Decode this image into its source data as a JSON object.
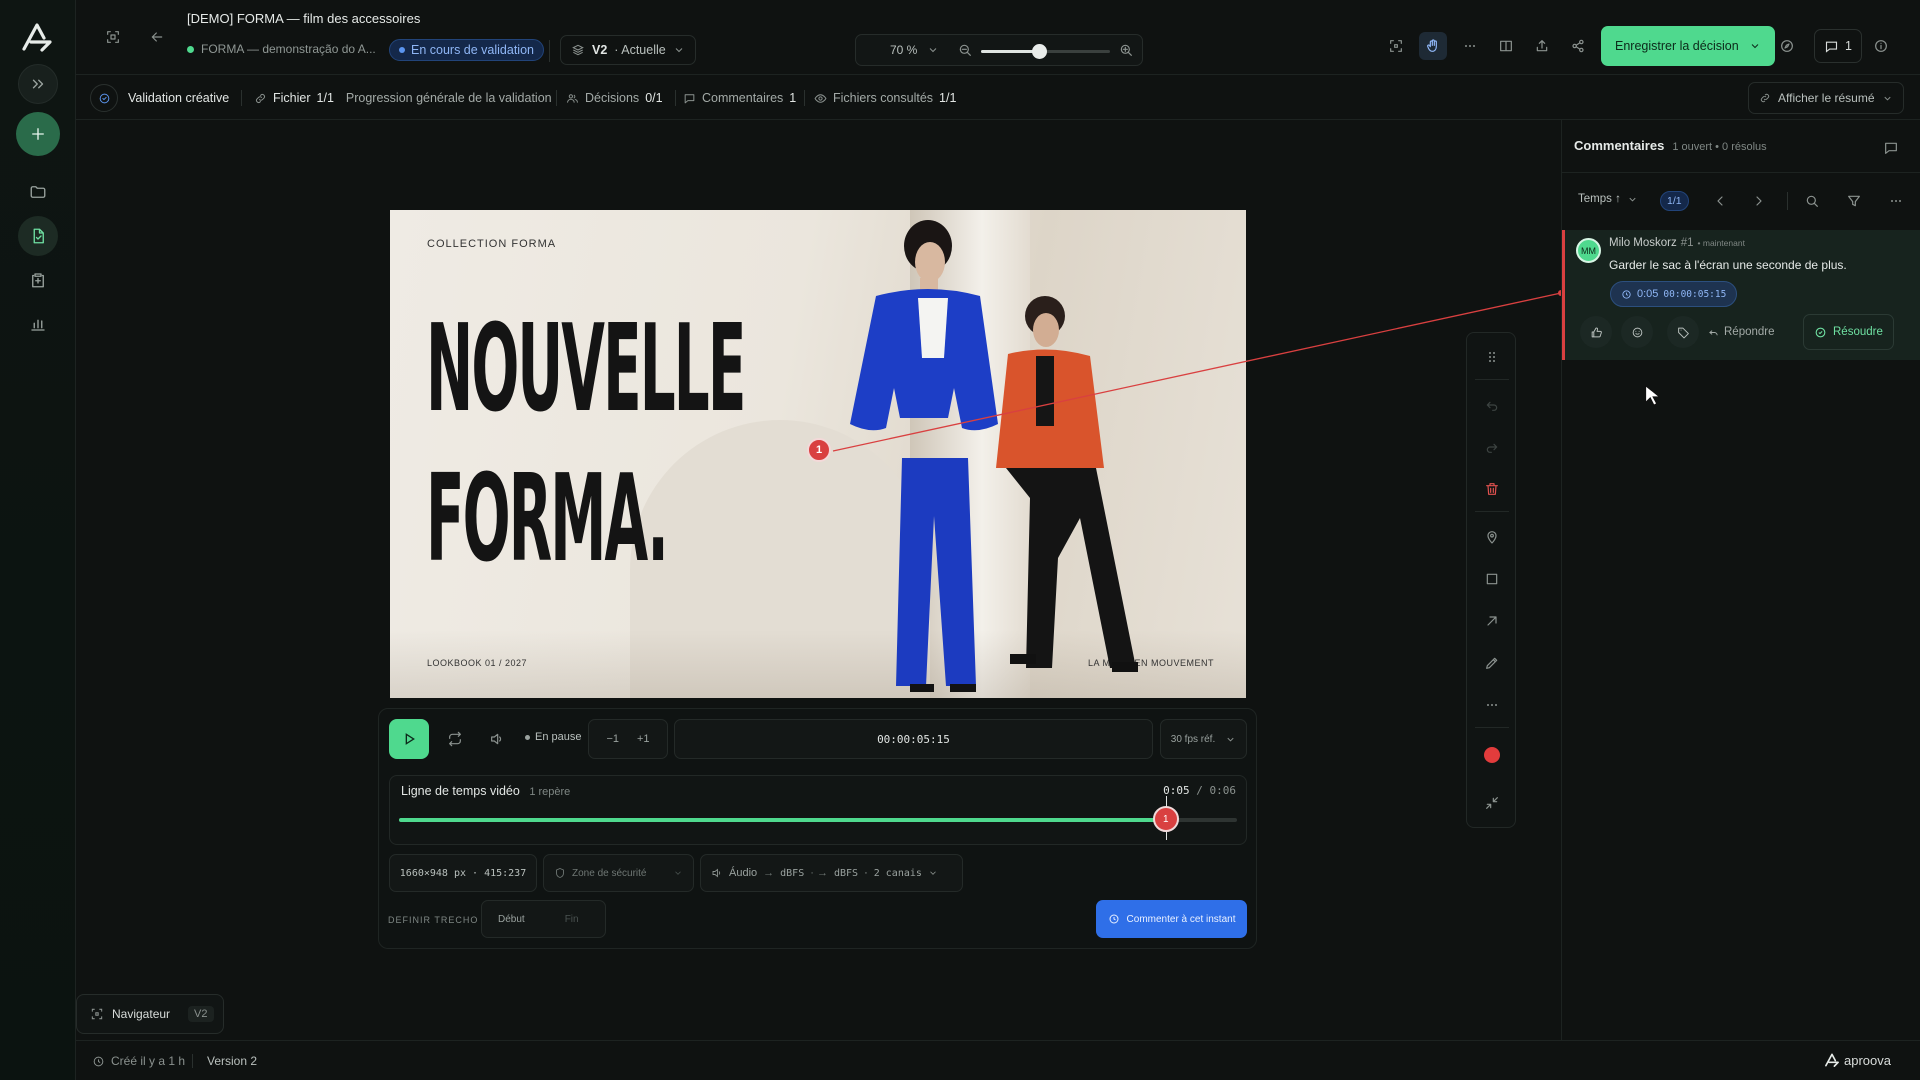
{
  "app": {
    "logo_name": "aproova",
    "brand_color": "#4fd98e",
    "accent_blue": "#2f6fe8",
    "marker_red": "#d94040"
  },
  "header": {
    "title": "[DEMO] FORMA — film des accessoires",
    "project": "FORMA — demonstração do A...",
    "status": "En cours de validation",
    "version_label": "V2",
    "version_state": "· Actuelle",
    "zoom": "70 %",
    "zoom_value": 0.45,
    "decision_button": "Enregistrer la décision",
    "comments_count": "1"
  },
  "subbar": {
    "validation": "Validation créative",
    "file_label": "Fichier",
    "file_value": "1/1",
    "progress": "Progression générale de la validation",
    "decisions_label": "Décisions",
    "decisions_value": "0/1",
    "comments_label": "Commentaires",
    "comments_value": "1",
    "viewed_label": "Fichiers consultés",
    "viewed_value": "1/1",
    "summary": "Afficher le résumé"
  },
  "poster": {
    "collection": "COLLECTION FORMA",
    "headline_1": "NOUVELLE",
    "headline_2": "FORMA.",
    "lookbook": "LOOKBOOK 01 / 2027",
    "tagline": "LA MODE EN MOUVEMENT",
    "marker": "1"
  },
  "player": {
    "state": "En pause",
    "minus": "−1",
    "plus": "+1",
    "timecode": "00:00:05:15",
    "fps": "30 fps réf.",
    "timeline_title": "Ligne de temps vidéo",
    "timeline_markers": "1 repère",
    "current": "0:05",
    "slash": "/",
    "duration": "0:06",
    "progress": 0.915,
    "playhead_marker": "1",
    "resolution": "1660×948 px · 415:237",
    "safe_zone": "Zone de sécurité",
    "audio_label": "Áudio",
    "audio_l": "dBFS",
    "audio_r": "dBFS",
    "channels": "2 canais",
    "define_range": "DEFINIR TRECHO",
    "start": "Début",
    "end": "Fin",
    "comment_button": "Commenter à cet instant"
  },
  "comments": {
    "title": "Commentaires",
    "meta": "1 ouvert • 0 résolus",
    "sort": "Temps ↑",
    "pager": "1/1",
    "items": [
      {
        "initials": "MM",
        "author": "Milo Moskorz",
        "number": "#1",
        "when": "• maintenant",
        "text": "Garder le sac à l'écran une seconde de plus.",
        "time_short": "0:05",
        "time_code": "00:00:05:15",
        "reply": "Répondre",
        "resolve": "Résoudre"
      }
    ]
  },
  "navigator": {
    "label": "Navigateur",
    "version": "V2"
  },
  "footer": {
    "created": "Créé il y a 1 h",
    "version": "Version 2",
    "brand": "aproova"
  }
}
